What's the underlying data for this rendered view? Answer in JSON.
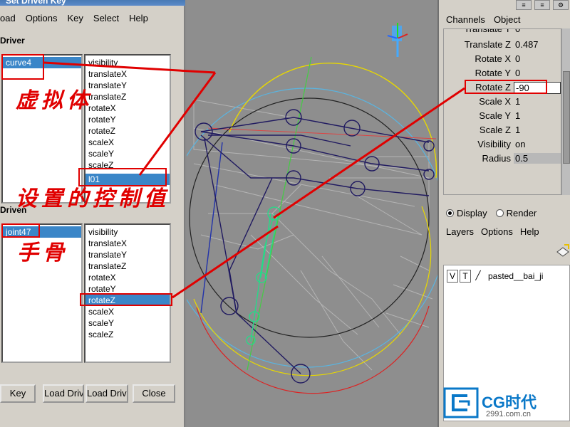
{
  "sdk": {
    "title": "Set Driven Key",
    "menu": [
      "oad",
      "Options",
      "Key",
      "Select",
      "Help"
    ],
    "driver_label": "Driver",
    "driven_label": "Driven",
    "driver_object": "curve4",
    "driver_attrs": [
      "visibility",
      "translateX",
      "translateY",
      "translateZ",
      "rotateX",
      "rotateY",
      "rotateZ",
      "scaleX",
      "scaleY",
      "scaleZ",
      "l01"
    ],
    "driver_selected_attr": "l01",
    "driven_object": "joint47",
    "driven_attrs": [
      "visibility",
      "translateX",
      "translateY",
      "translateZ",
      "rotateX",
      "rotateY",
      "rotateZ",
      "scaleX",
      "scaleY",
      "scaleZ"
    ],
    "driven_selected_attr": "rotateZ",
    "buttons": {
      "key": "Key",
      "load_driver": "Load Driver",
      "load_driven": "Load Driven",
      "close": "Close"
    }
  },
  "channels": {
    "menu": [
      "Channels",
      "Object"
    ],
    "attributes": [
      {
        "name": "Translate Y",
        "value": "0"
      },
      {
        "name": "Translate Z",
        "value": "0.487"
      },
      {
        "name": "Rotate X",
        "value": "0"
      },
      {
        "name": "Rotate Y",
        "value": "0"
      },
      {
        "name": "Rotate Z",
        "value": "-90"
      },
      {
        "name": "Scale X",
        "value": "1"
      },
      {
        "name": "Scale Y",
        "value": "1"
      },
      {
        "name": "Scale Z",
        "value": "1"
      },
      {
        "name": "Visibility",
        "value": "on"
      },
      {
        "name": "Radius",
        "value": "0.5"
      }
    ]
  },
  "layers": {
    "display_label": "Display",
    "render_label": "Render",
    "display_selected": true,
    "menu": [
      "Layers",
      "Options",
      "Help"
    ],
    "layer": {
      "v": "V",
      "t": "T",
      "name": "pasted__bai_ji"
    }
  },
  "annotations": {
    "virtual_label": "虚拟体",
    "control_value_label": "设置的控制值",
    "hand_bone_label": "手骨"
  },
  "watermark": {
    "text": "CG时代",
    "url": "2991.com.cn"
  },
  "colors": {
    "annotation": "#e00000",
    "selection": "#3a86c8",
    "joint": "#22dd88"
  }
}
